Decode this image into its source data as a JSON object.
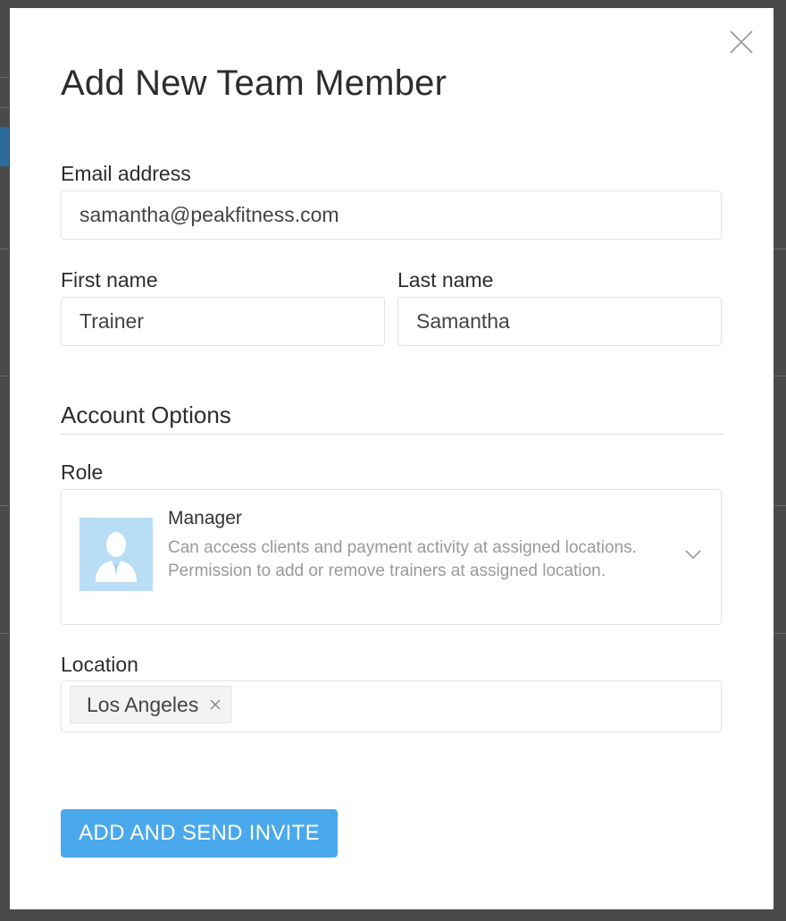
{
  "modal": {
    "title": "Add New Team Member",
    "close_icon": "close-icon"
  },
  "email": {
    "label": "Email address",
    "value": "samantha@peakfitness.com"
  },
  "first_name": {
    "label": "First name",
    "value": "Trainer"
  },
  "last_name": {
    "label": "Last name",
    "value": "Samantha"
  },
  "account_options": {
    "heading": "Account Options"
  },
  "role": {
    "label": "Role",
    "selected_name": "Manager",
    "selected_description": "Can access clients and payment activity at assigned locations. Permission to add or remove trainers at assigned location.",
    "avatar_icon": "manager-avatar-icon",
    "dropdown_icon": "chevron-down-icon",
    "avatar_color": "#b8ddf5"
  },
  "location": {
    "label": "Location",
    "tags": [
      "Los Angeles"
    ],
    "remove_icon": "remove-tag-icon"
  },
  "actions": {
    "submit_label": "ADD AND SEND INVITE",
    "submit_color": "#4aa8ec"
  }
}
